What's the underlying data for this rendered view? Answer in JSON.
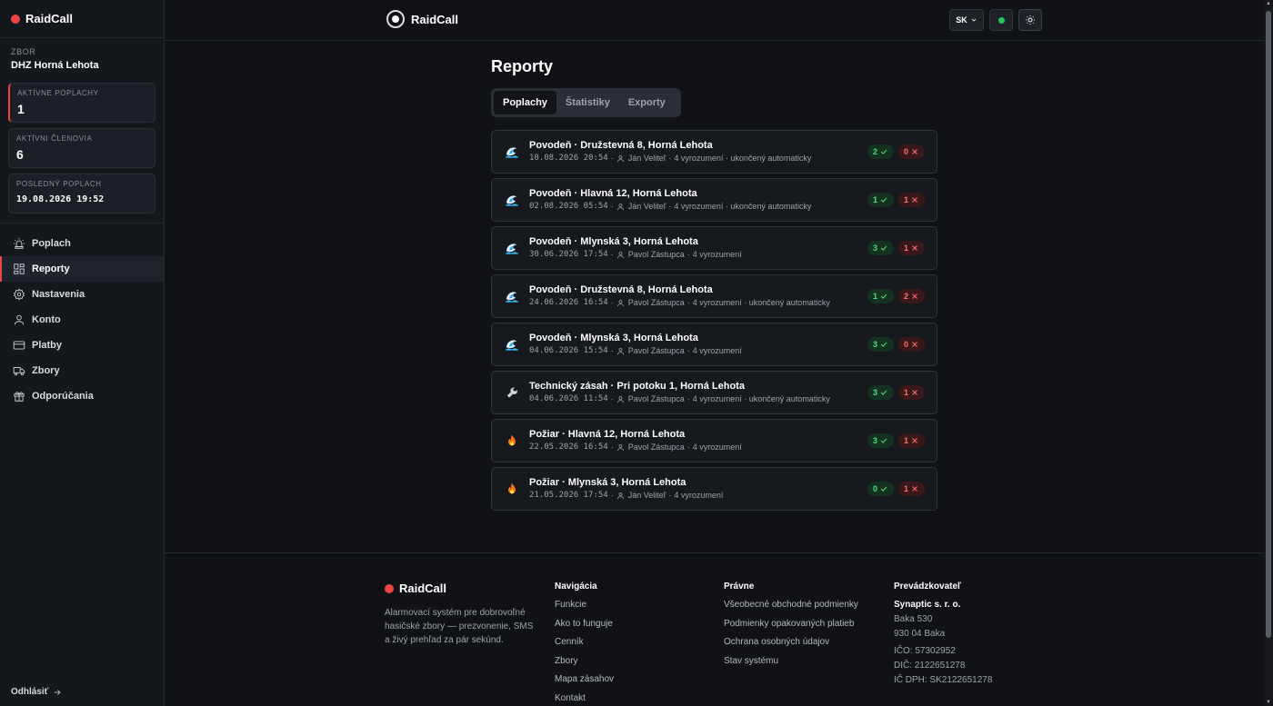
{
  "app": {
    "name": "RaidCall"
  },
  "sidebar": {
    "org_label": "ZBOR",
    "org_name": "DHZ Horná Lehota",
    "stats": [
      {
        "label": "AKTÍVNE POPLACHY",
        "value": "1"
      },
      {
        "label": "AKTÍVNI ČLENOVIA",
        "value": "6"
      },
      {
        "label": "POSLEDNÝ POPLACH",
        "value": "19.08.2026 19:52"
      }
    ],
    "nav": [
      {
        "label": "Poplach",
        "icon": "siren-icon"
      },
      {
        "label": "Reporty",
        "icon": "grid-icon"
      },
      {
        "label": "Nastavenia",
        "icon": "gear-icon"
      },
      {
        "label": "Konto",
        "icon": "user-icon"
      },
      {
        "label": "Platby",
        "icon": "card-icon"
      },
      {
        "label": "Zbory",
        "icon": "truck-icon"
      },
      {
        "label": "Odporúčania",
        "icon": "gift-icon"
      }
    ],
    "logout": "Odhlásiť"
  },
  "topbar": {
    "lang": "SK"
  },
  "page": {
    "title": "Reporty",
    "tabs": [
      "Poplachy",
      "Štatistiky",
      "Exporty"
    ]
  },
  "reports": [
    {
      "type": "flood",
      "title": "Povodeň · Družstevná 8, Horná Lehota",
      "date": "10.08.2026 20:54",
      "person": "Ján Veliteľ",
      "info": "4 vyrozumení · ukončený automaticky",
      "ok": "2",
      "no": "0"
    },
    {
      "type": "flood",
      "title": "Povodeň · Hlavná 12, Horná Lehota",
      "date": "02.08.2026 05:54",
      "person": "Ján Veliteľ",
      "info": "4 vyrozumení · ukončený automaticky",
      "ok": "1",
      "no": "1"
    },
    {
      "type": "flood",
      "title": "Povodeň · Mlynská 3, Horná Lehota",
      "date": "30.06.2026 17:54",
      "person": "Pavol Zástupca",
      "info": "4 vyrozumení",
      "ok": "3",
      "no": "1"
    },
    {
      "type": "flood",
      "title": "Povodeň · Družstevná 8, Horná Lehota",
      "date": "24.06.2026 16:54",
      "person": "Pavol Zástupca",
      "info": "4 vyrozumení · ukončený automaticky",
      "ok": "1",
      "no": "2"
    },
    {
      "type": "flood",
      "title": "Povodeň · Mlynská 3, Horná Lehota",
      "date": "04.06.2026 15:54",
      "person": "Pavol Zástupca",
      "info": "4 vyrozumení",
      "ok": "3",
      "no": "0"
    },
    {
      "type": "tech",
      "title": "Technický zásah · Pri potoku 1, Horná Lehota",
      "date": "04.06.2026 11:54",
      "person": "Pavol Zástupca",
      "info": "4 vyrozumení · ukončený automaticky",
      "ok": "3",
      "no": "1"
    },
    {
      "type": "fire",
      "title": "Požiar · Hlavná 12, Horná Lehota",
      "date": "22.05.2026 16:54",
      "person": "Pavol Zástupca",
      "info": "4 vyrozumení",
      "ok": "3",
      "no": "1"
    },
    {
      "type": "fire",
      "title": "Požiar · Mlynská 3, Horná Lehota",
      "date": "21.05.2026 17:54",
      "person": "Ján Veliteľ",
      "info": "4 vyrozumení",
      "ok": "0",
      "no": "1"
    }
  ],
  "footer": {
    "description": "Alarmovací systém pre dobrovoľné hasičské zbory — prezvonenie, SMS a živý prehľad za pár sekúnd.",
    "nav_head": "Navigácia",
    "nav_links": [
      "Funkcie",
      "Ako to funguje",
      "Cenník",
      "Zbory",
      "Mapa zásahov",
      "Kontakt"
    ],
    "legal_head": "Právne",
    "legal_links": [
      "Všeobecné obchodné podmienky",
      "Podmienky opakovaných platieb",
      "Ochrana osobných údajov",
      "Stav systému"
    ],
    "operator_head": "Prevádzkovateľ",
    "company": "Synaptic s. r. o.",
    "address1": "Baka 530",
    "address2": "930 04 Baka",
    "ico": "IČO: 57302952",
    "dic": "DIČ: 2122651278",
    "icdph": "IČ DPH: SK2122651278"
  },
  "colors": {
    "accent": "#ef4444",
    "ok": "#4ade80",
    "no": "#f87171",
    "online": "#22c55e"
  }
}
